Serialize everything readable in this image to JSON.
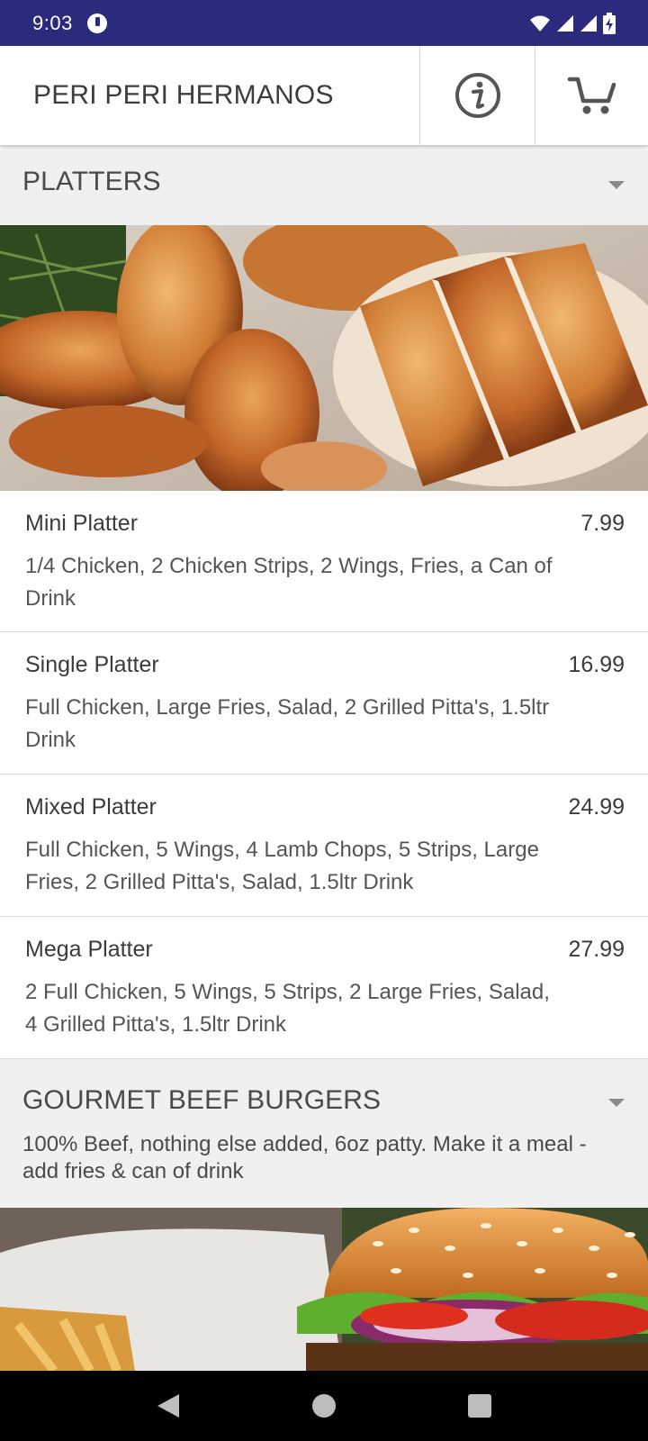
{
  "status_bar": {
    "time": "9:03"
  },
  "app_bar": {
    "title": "PERI PERI HERMANOS",
    "info_icon": "info-icon",
    "cart_icon": "cart-icon"
  },
  "sections": [
    {
      "title": "PLATTERS",
      "items": [
        {
          "name": "Mini Platter",
          "price": "7.99",
          "description": "1/4 Chicken, 2 Chicken Strips, 2 Wings, Fries, a Can of Drink"
        },
        {
          "name": "Single Platter",
          "price": "16.99",
          "description": "Full Chicken, Large Fries, Salad, 2 Grilled Pitta's, 1.5ltr Drink"
        },
        {
          "name": "Mixed Platter",
          "price": "24.99",
          "description": "Full Chicken, 5 Wings, 4 Lamb Chops, 5 Strips, Large Fries, 2 Grilled Pitta's, Salad, 1.5ltr Drink"
        },
        {
          "name": "Mega Platter",
          "price": "27.99",
          "description": "2 Full Chicken, 5 Wings, 5 Strips, 2 Large Fries, Salad, 4 Grilled Pitta's, 1.5ltr Drink"
        }
      ]
    },
    {
      "title": "GOURMET BEEF BURGERS",
      "description": "100% Beef, nothing else added, 6oz patty. Make it a meal - add fries & can of drink"
    }
  ],
  "colors": {
    "status_bar": "#2b2a7c",
    "section_bg": "#f0f0f0",
    "text": "#3b3b3b"
  }
}
